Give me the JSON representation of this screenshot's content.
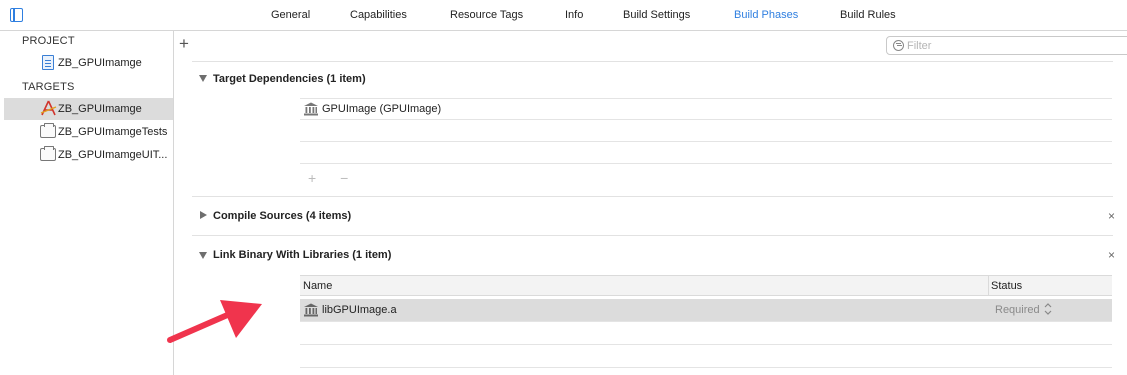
{
  "topbar": {
    "tabs": [
      {
        "label": "General",
        "active": false
      },
      {
        "label": "Capabilities",
        "active": false
      },
      {
        "label": "Resource Tags",
        "active": false
      },
      {
        "label": "Info",
        "active": false
      },
      {
        "label": "Build Settings",
        "active": false
      },
      {
        "label": "Build Phases",
        "active": true
      },
      {
        "label": "Build Rules",
        "active": false
      }
    ],
    "accent_color": "#2f7fe0"
  },
  "sidebar": {
    "project_header": "PROJECT",
    "project_item": {
      "label": "ZB_GPUImamge",
      "icon": "project-file-icon"
    },
    "targets_header": "TARGETS",
    "targets": [
      {
        "label": "ZB_GPUImamge",
        "icon": "app-target-icon",
        "selected": true
      },
      {
        "label": "ZB_GPUImamgeTests",
        "icon": "test-bundle-icon",
        "selected": false
      },
      {
        "label": "ZB_GPUImamgeUIT...",
        "icon": "test-bundle-icon",
        "selected": false
      }
    ]
  },
  "main": {
    "add_label": "+",
    "filter": {
      "placeholder": "Filter"
    },
    "phases": {
      "target_dependencies": {
        "title": "Target Dependencies (1 item)",
        "expanded": true,
        "items": [
          {
            "label": "GPUImage (GPUImage)",
            "icon": "library-icon"
          }
        ],
        "add_remove": "+ −"
      },
      "compile_sources": {
        "title": "Compile Sources (4 items)",
        "expanded": false,
        "close": "×"
      },
      "link_binary": {
        "title": "Link Binary With Libraries (1 item)",
        "expanded": true,
        "close": "×",
        "columns": {
          "name": "Name",
          "status": "Status"
        },
        "rows": [
          {
            "name": "libGPUImage.a",
            "status": "Required",
            "icon": "library-icon",
            "selected": true
          }
        ]
      }
    }
  },
  "annotation": {
    "color": "#f0344d",
    "icon": "red-arrow-annotation"
  }
}
